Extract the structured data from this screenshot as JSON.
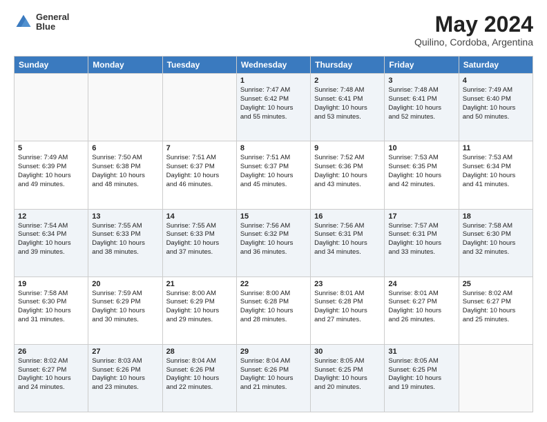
{
  "header": {
    "logo_line1": "General",
    "logo_line2": "Blue",
    "title": "May 2024",
    "subtitle": "Quilino, Cordoba, Argentina"
  },
  "days_of_week": [
    "Sunday",
    "Monday",
    "Tuesday",
    "Wednesday",
    "Thursday",
    "Friday",
    "Saturday"
  ],
  "weeks": [
    [
      {
        "day": "",
        "content": ""
      },
      {
        "day": "",
        "content": ""
      },
      {
        "day": "",
        "content": ""
      },
      {
        "day": "1",
        "content": "Sunrise: 7:47 AM\nSunset: 6:42 PM\nDaylight: 10 hours\nand 55 minutes."
      },
      {
        "day": "2",
        "content": "Sunrise: 7:48 AM\nSunset: 6:41 PM\nDaylight: 10 hours\nand 53 minutes."
      },
      {
        "day": "3",
        "content": "Sunrise: 7:48 AM\nSunset: 6:41 PM\nDaylight: 10 hours\nand 52 minutes."
      },
      {
        "day": "4",
        "content": "Sunrise: 7:49 AM\nSunset: 6:40 PM\nDaylight: 10 hours\nand 50 minutes."
      }
    ],
    [
      {
        "day": "5",
        "content": "Sunrise: 7:49 AM\nSunset: 6:39 PM\nDaylight: 10 hours\nand 49 minutes."
      },
      {
        "day": "6",
        "content": "Sunrise: 7:50 AM\nSunset: 6:38 PM\nDaylight: 10 hours\nand 48 minutes."
      },
      {
        "day": "7",
        "content": "Sunrise: 7:51 AM\nSunset: 6:37 PM\nDaylight: 10 hours\nand 46 minutes."
      },
      {
        "day": "8",
        "content": "Sunrise: 7:51 AM\nSunset: 6:37 PM\nDaylight: 10 hours\nand 45 minutes."
      },
      {
        "day": "9",
        "content": "Sunrise: 7:52 AM\nSunset: 6:36 PM\nDaylight: 10 hours\nand 43 minutes."
      },
      {
        "day": "10",
        "content": "Sunrise: 7:53 AM\nSunset: 6:35 PM\nDaylight: 10 hours\nand 42 minutes."
      },
      {
        "day": "11",
        "content": "Sunrise: 7:53 AM\nSunset: 6:34 PM\nDaylight: 10 hours\nand 41 minutes."
      }
    ],
    [
      {
        "day": "12",
        "content": "Sunrise: 7:54 AM\nSunset: 6:34 PM\nDaylight: 10 hours\nand 39 minutes."
      },
      {
        "day": "13",
        "content": "Sunrise: 7:55 AM\nSunset: 6:33 PM\nDaylight: 10 hours\nand 38 minutes."
      },
      {
        "day": "14",
        "content": "Sunrise: 7:55 AM\nSunset: 6:33 PM\nDaylight: 10 hours\nand 37 minutes."
      },
      {
        "day": "15",
        "content": "Sunrise: 7:56 AM\nSunset: 6:32 PM\nDaylight: 10 hours\nand 36 minutes."
      },
      {
        "day": "16",
        "content": "Sunrise: 7:56 AM\nSunset: 6:31 PM\nDaylight: 10 hours\nand 34 minutes."
      },
      {
        "day": "17",
        "content": "Sunrise: 7:57 AM\nSunset: 6:31 PM\nDaylight: 10 hours\nand 33 minutes."
      },
      {
        "day": "18",
        "content": "Sunrise: 7:58 AM\nSunset: 6:30 PM\nDaylight: 10 hours\nand 32 minutes."
      }
    ],
    [
      {
        "day": "19",
        "content": "Sunrise: 7:58 AM\nSunset: 6:30 PM\nDaylight: 10 hours\nand 31 minutes."
      },
      {
        "day": "20",
        "content": "Sunrise: 7:59 AM\nSunset: 6:29 PM\nDaylight: 10 hours\nand 30 minutes."
      },
      {
        "day": "21",
        "content": "Sunrise: 8:00 AM\nSunset: 6:29 PM\nDaylight: 10 hours\nand 29 minutes."
      },
      {
        "day": "22",
        "content": "Sunrise: 8:00 AM\nSunset: 6:28 PM\nDaylight: 10 hours\nand 28 minutes."
      },
      {
        "day": "23",
        "content": "Sunrise: 8:01 AM\nSunset: 6:28 PM\nDaylight: 10 hours\nand 27 minutes."
      },
      {
        "day": "24",
        "content": "Sunrise: 8:01 AM\nSunset: 6:27 PM\nDaylight: 10 hours\nand 26 minutes."
      },
      {
        "day": "25",
        "content": "Sunrise: 8:02 AM\nSunset: 6:27 PM\nDaylight: 10 hours\nand 25 minutes."
      }
    ],
    [
      {
        "day": "26",
        "content": "Sunrise: 8:02 AM\nSunset: 6:27 PM\nDaylight: 10 hours\nand 24 minutes."
      },
      {
        "day": "27",
        "content": "Sunrise: 8:03 AM\nSunset: 6:26 PM\nDaylight: 10 hours\nand 23 minutes."
      },
      {
        "day": "28",
        "content": "Sunrise: 8:04 AM\nSunset: 6:26 PM\nDaylight: 10 hours\nand 22 minutes."
      },
      {
        "day": "29",
        "content": "Sunrise: 8:04 AM\nSunset: 6:26 PM\nDaylight: 10 hours\nand 21 minutes."
      },
      {
        "day": "30",
        "content": "Sunrise: 8:05 AM\nSunset: 6:25 PM\nDaylight: 10 hours\nand 20 minutes."
      },
      {
        "day": "31",
        "content": "Sunrise: 8:05 AM\nSunset: 6:25 PM\nDaylight: 10 hours\nand 19 minutes."
      },
      {
        "day": "",
        "content": ""
      }
    ]
  ]
}
